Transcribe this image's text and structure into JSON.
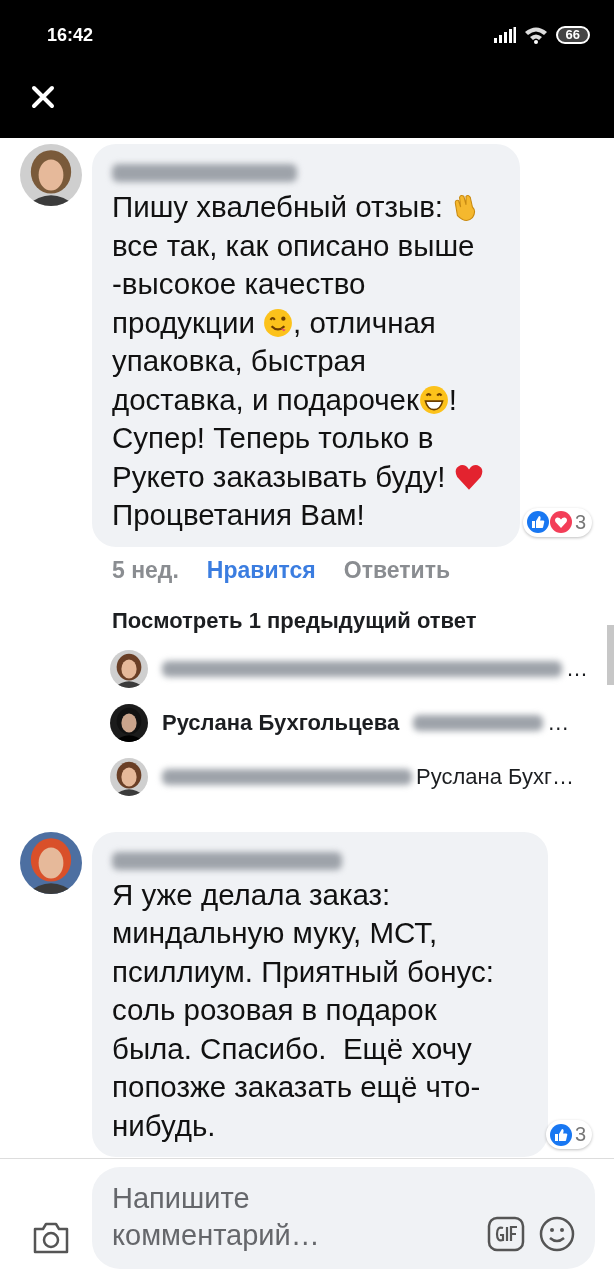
{
  "status_bar": {
    "time": "16:42",
    "battery": "66"
  },
  "comments": [
    {
      "body": [
        {
          "kind": "text",
          "text": "Пишу хвалебный отзыв: "
        },
        {
          "kind": "clap"
        },
        {
          "kind": "text",
          "text": " все так, как описано выше -высокое качество продукции "
        },
        {
          "kind": "wink"
        },
        {
          "kind": "text",
          "text": ", отличная упаковка, быстрая доставка, и подарочек"
        },
        {
          "kind": "grin"
        },
        {
          "kind": "text",
          "text": "! Супер! Теперь только в Рукето заказывать буду! "
        },
        {
          "kind": "heart"
        },
        {
          "kind": "text",
          "text": " Процветания Вам!"
        }
      ],
      "reactions": {
        "icons": [
          {
            "kind": "like"
          },
          {
            "kind": "love"
          }
        ],
        "count": "3"
      },
      "time": "5 нед.",
      "like": {
        "label": "Нравится",
        "selected": true
      },
      "reply": "Ответить",
      "replies_link": "Посмотреть 1 предыдущий ответ",
      "replies": [
        {
          "tail": "…"
        },
        {
          "name": "Руслана Бухгольцева",
          "tail": "…"
        },
        {
          "tail": "Руслана Бухг…"
        }
      ]
    },
    {
      "body": [
        {
          "kind": "text",
          "text": "Я уже делала заказ: миндальную муку, МСТ, псиллиум. Приятный бонус: соль розовая в подарок была. Спасибо.  Ещё хочу попозже заказать ещё что-нибудь."
        }
      ],
      "reactions": {
        "icons": [
          {
            "kind": "like"
          }
        ],
        "count": "3"
      }
    }
  ],
  "composer": {
    "placeholder": "Напишите комментарий…"
  }
}
